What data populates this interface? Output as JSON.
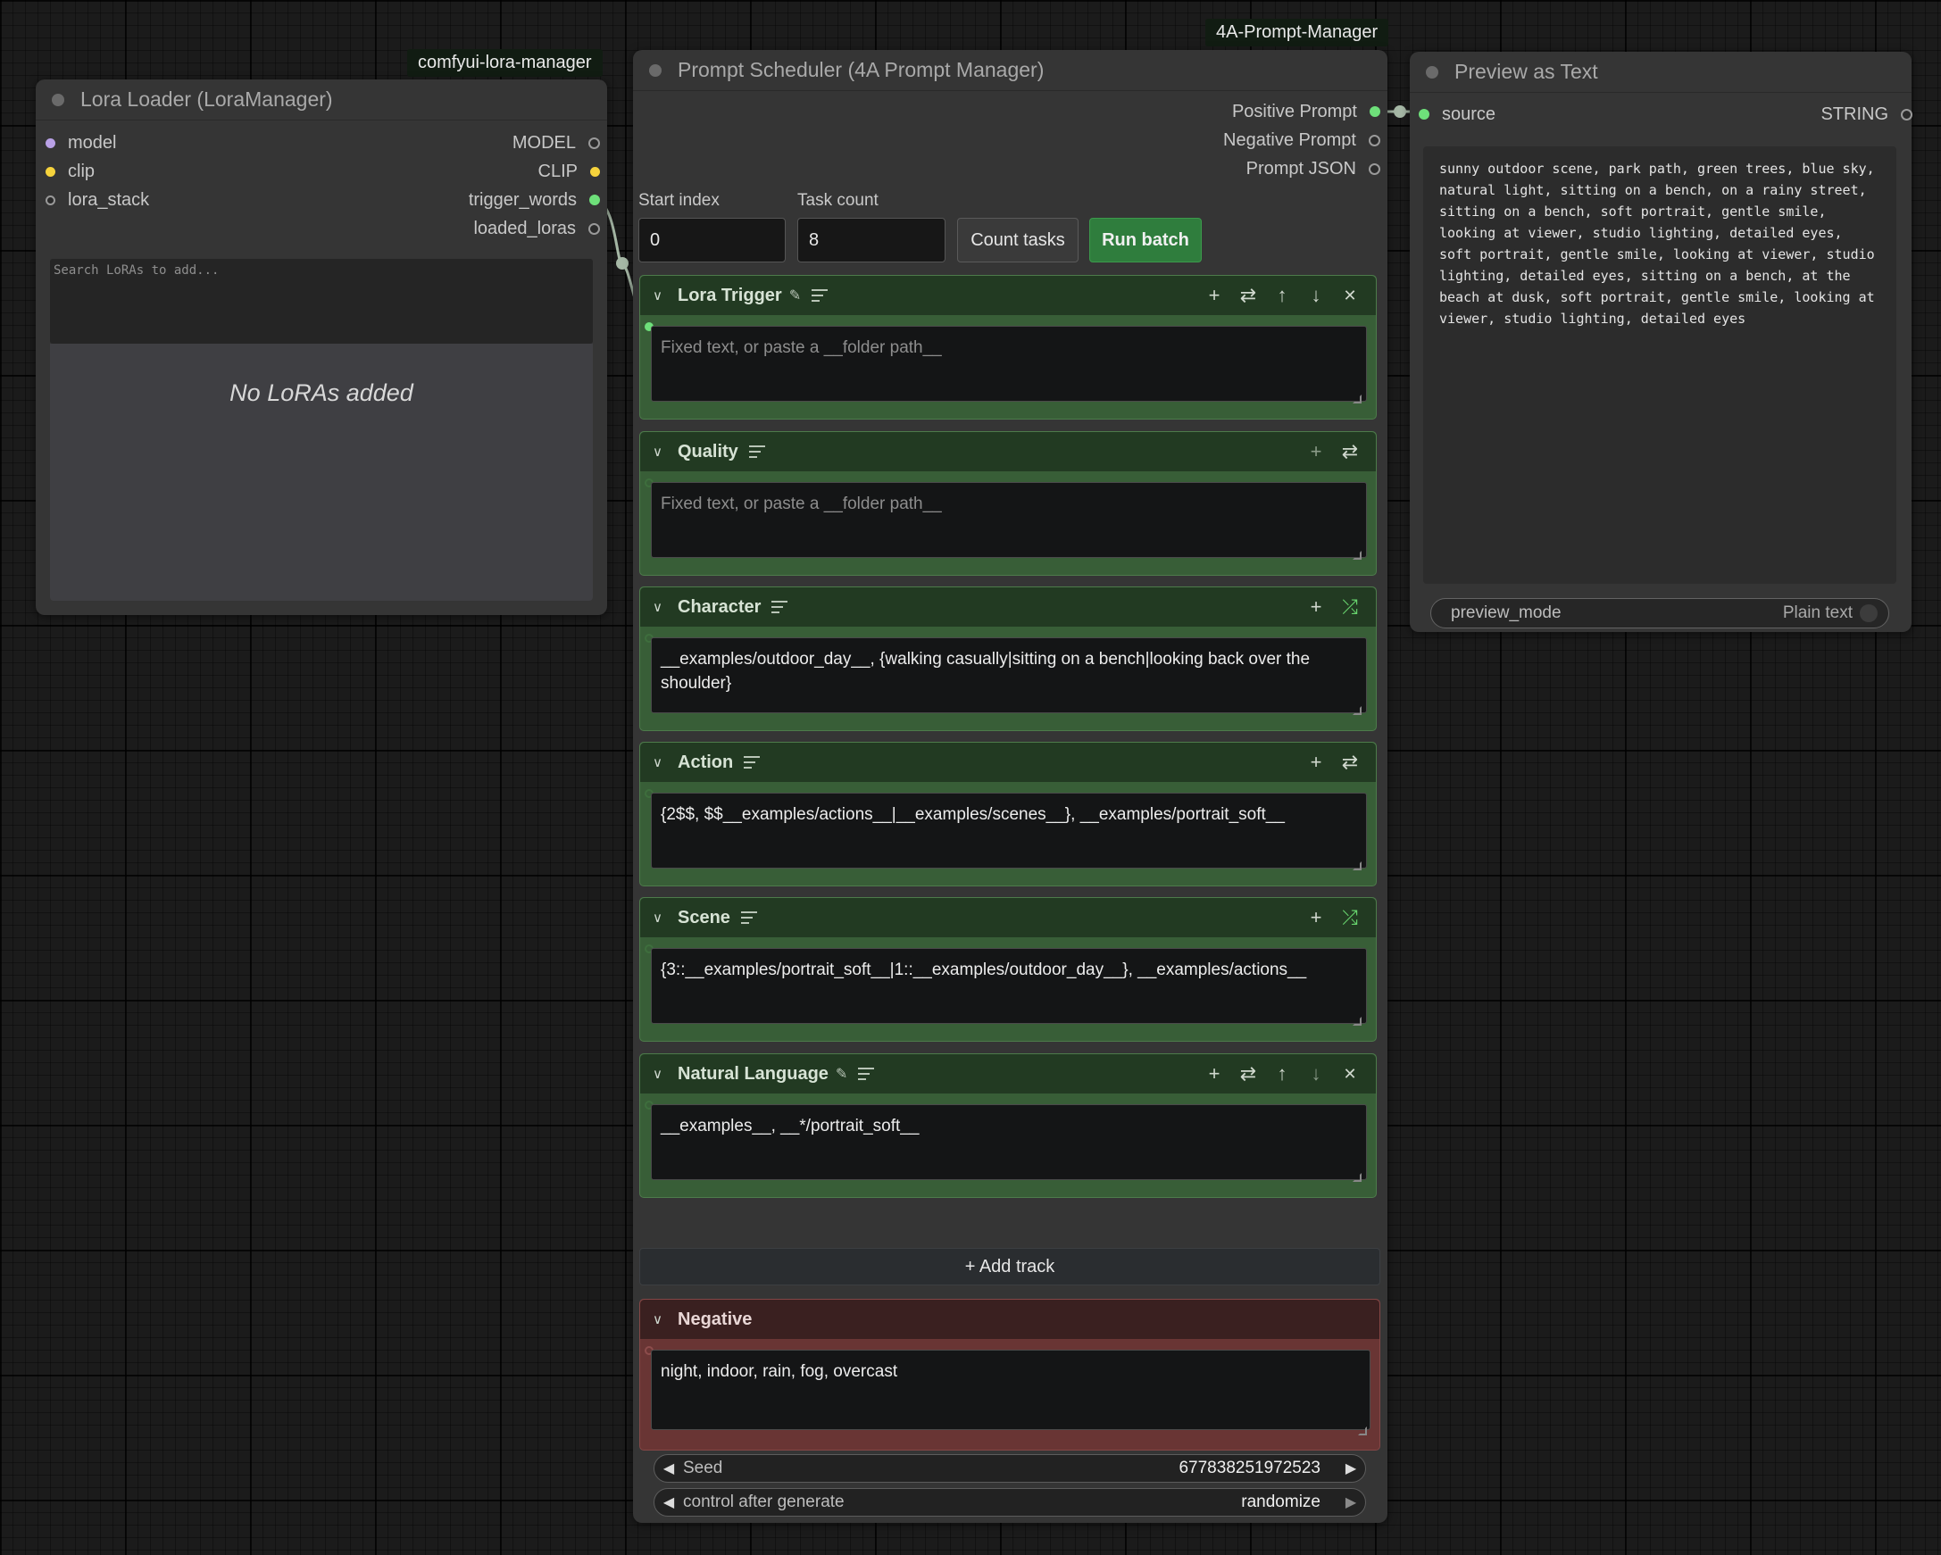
{
  "lora_loader": {
    "badge": "comfyui-lora-manager",
    "title": "Lora Loader (LoraManager)",
    "inputs": [
      "model",
      "clip",
      "lora_stack"
    ],
    "outputs": [
      "MODEL",
      "CLIP",
      "trigger_words",
      "loaded_loras"
    ],
    "search_placeholder": "Search LoRAs to add...",
    "empty_text": "No LoRAs added"
  },
  "scheduler": {
    "badge": "4A-Prompt-Manager",
    "title": "Prompt Scheduler (4A Prompt Manager)",
    "outputs": [
      "Positive Prompt",
      "Negative Prompt",
      "Prompt JSON"
    ],
    "start_index_label": "Start index",
    "start_index_value": "0",
    "task_count_label": "Task count",
    "task_count_value": "8",
    "count_tasks_label": "Count tasks",
    "run_batch_label": "Run batch",
    "placeholder": "Fixed text, or paste a __folder path__",
    "tracks": [
      {
        "name": "Lora Trigger",
        "text": ""
      },
      {
        "name": "Quality",
        "text": ""
      },
      {
        "name": "Character",
        "text": "__examples/outdoor_day__, {walking casually|sitting on a bench|looking back over the shoulder}"
      },
      {
        "name": "Action",
        "text": "{2$$, $$__examples/actions__|__examples/scenes__}, __examples/portrait_soft__"
      },
      {
        "name": "Scene",
        "text": "{3::__examples/portrait_soft__|1::__examples/outdoor_day__}, __examples/actions__"
      },
      {
        "name": "Natural Language",
        "text": "__examples__, __*/portrait_soft__"
      }
    ],
    "add_track_label": "+ Add track",
    "negative": {
      "name": "Negative",
      "text": "night, indoor, rain, fog, overcast"
    },
    "seed": {
      "label": "Seed",
      "value": "677838251972523"
    },
    "control_after_generate": {
      "label": "control after generate",
      "value": "randomize"
    }
  },
  "preview": {
    "title": "Preview as Text",
    "input": "source",
    "output": "STRING",
    "text": "sunny outdoor scene, park path, green trees, blue sky, natural light, sitting on a bench, on a rainy street, sitting on a bench, soft portrait, gentle smile, looking at viewer, studio lighting, detailed eyes, soft portrait, gentle smile, looking at viewer, studio lighting, detailed eyes, sitting on a bench, at the beach at dusk, soft portrait, gentle smile, looking at viewer, studio lighting, detailed eyes",
    "mode_label": "preview_mode",
    "mode_value": "Plain text"
  },
  "colors": {
    "canvas": "#1b1b1b",
    "node": "#353535",
    "track_green": "#385e37",
    "negative_red": "#693534",
    "connected": "#6ee07a",
    "run_batch": "#2f7d3d"
  }
}
